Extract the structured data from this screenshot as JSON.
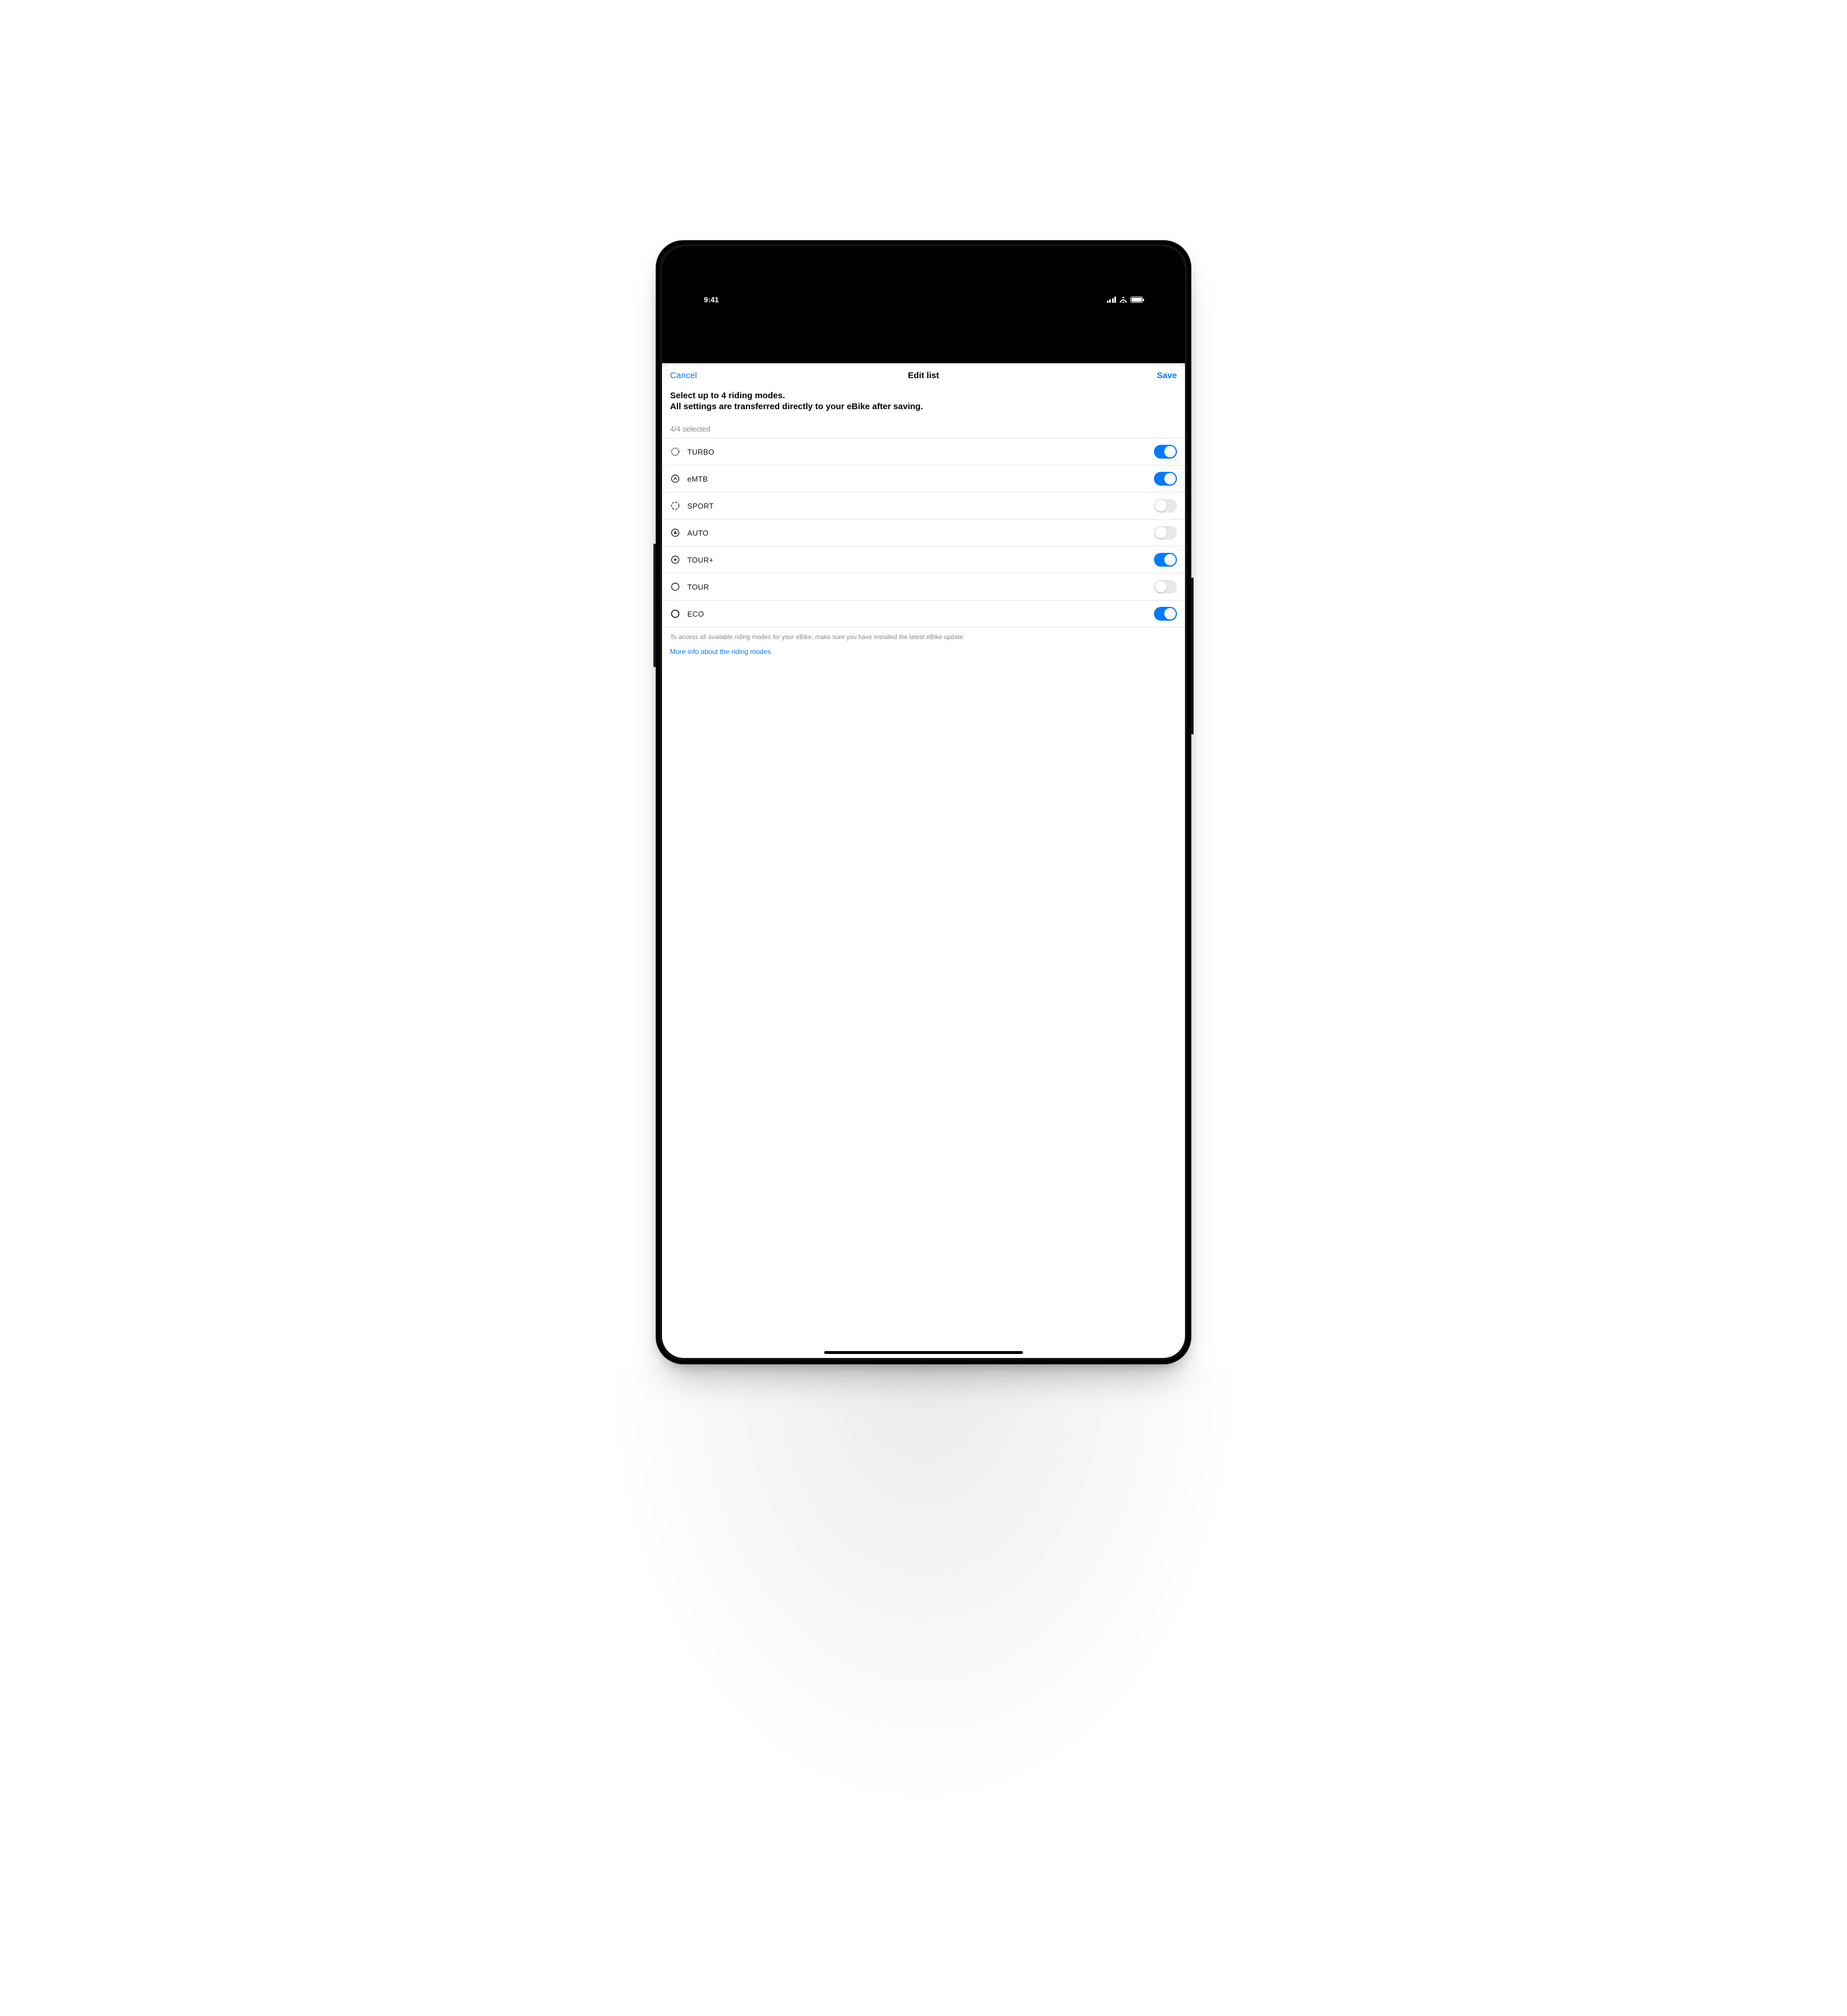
{
  "status": {
    "time": "9:41"
  },
  "nav": {
    "cancel": "Cancel",
    "title": "Edit list",
    "save": "Save"
  },
  "headline": {
    "line1": "Select up to 4 riding modes.",
    "line2": "All settings are transferred directly to your eBike after saving."
  },
  "counter": "4/4 selected",
  "modes": [
    {
      "id": "turbo",
      "label": "TURBO",
      "on": true
    },
    {
      "id": "emtb",
      "label": "eMTB",
      "on": true
    },
    {
      "id": "sport",
      "label": "SPORT",
      "on": false
    },
    {
      "id": "auto",
      "label": "AUTO",
      "on": false
    },
    {
      "id": "tourplus",
      "label": "TOUR+",
      "on": true
    },
    {
      "id": "tour",
      "label": "TOUR",
      "on": false
    },
    {
      "id": "eco",
      "label": "ECO",
      "on": true
    }
  ],
  "footnote": "To access all available riding modes for your eBike, make sure you have installed the latest eBike update.",
  "link": "More info about the riding modes",
  "colors": {
    "accent": "#007aff"
  }
}
